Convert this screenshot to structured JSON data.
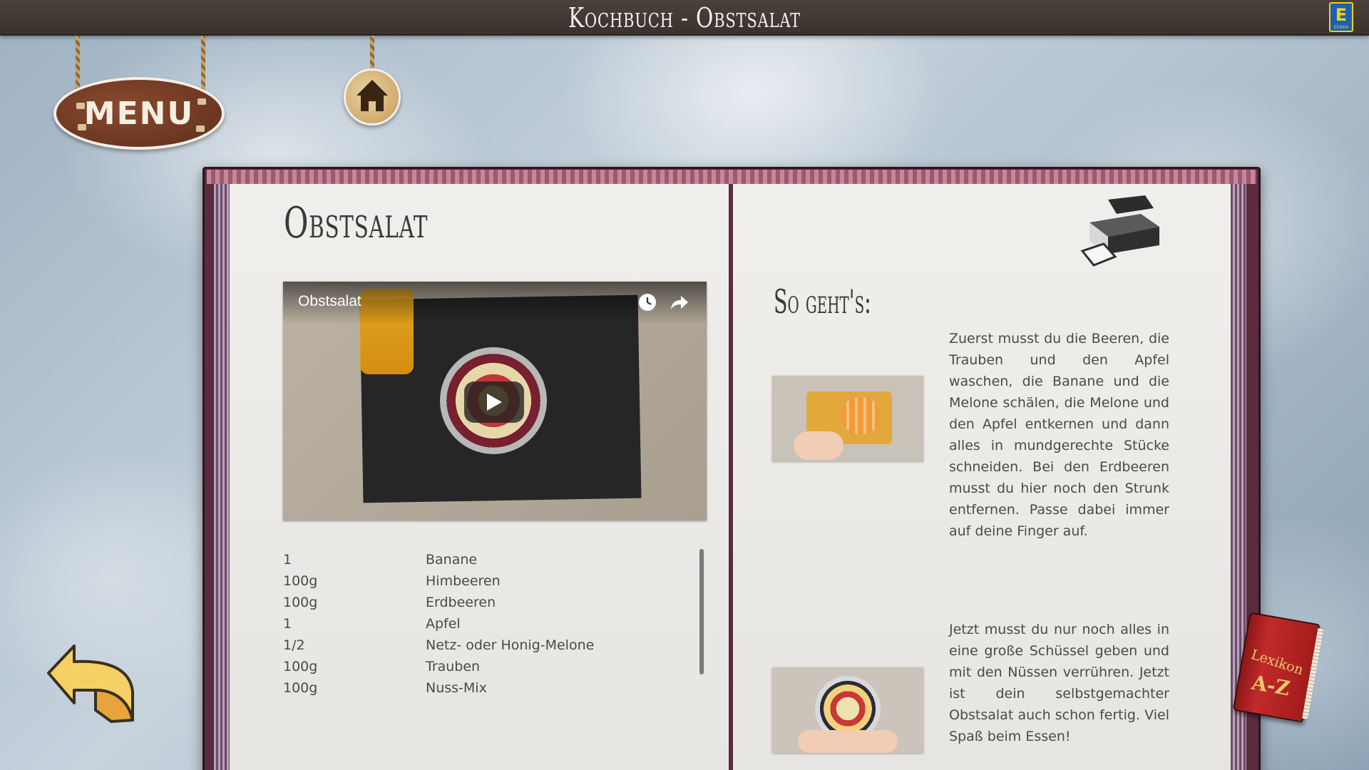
{
  "header": {
    "title": "Kochbuch - Obstsalat",
    "logo_letter": "E",
    "logo_word": "EDEKA"
  },
  "nav": {
    "menu_label": "MENU",
    "home_icon": "house-icon",
    "back_icon": "back-arrow-icon"
  },
  "recipe": {
    "title": "Obstsalat",
    "video": {
      "title": "Obstsalat",
      "watch_later_icon": "clock-icon",
      "share_icon": "share-icon",
      "play_icon": "play-icon"
    },
    "ingredients": [
      {
        "amount": "1",
        "name": "Banane"
      },
      {
        "amount": "100g",
        "name": "Himbeeren"
      },
      {
        "amount": "100g",
        "name": "Erdbeeren"
      },
      {
        "amount": "1",
        "name": "Apfel"
      },
      {
        "amount": "1/2",
        "name": "Netz- oder Honig-Melone"
      },
      {
        "amount": "100g",
        "name": "Trauben"
      },
      {
        "amount": "100g",
        "name": "Nuss-Mix"
      }
    ]
  },
  "instructions": {
    "title": "So geht's:",
    "print_icon": "printer-icon",
    "steps": [
      {
        "text": "Zuerst musst du die Beeren, die Trauben und den Apfel waschen, die Banane und die Melone schälen, die Melone und den Apfel entkernen und dann alles in mundgerechte Stücke schneiden. Bei den Erdbeeren musst du hier noch den Strunk entfernen. Passe dabei immer auf deine Finger auf."
      },
      {
        "text": "Jetzt musst du nur noch alles in eine große Schüssel geben und mit den Nüssen verrühren. Jetzt ist dein selbstgemachter Obstsalat auch schon fertig. Viel Spaß beim Essen!"
      }
    ]
  },
  "lexikon": {
    "label_top": "Lexikon",
    "label_bottom": "A-Z"
  },
  "colors": {
    "topbar": "#3f3731",
    "book_cover": "#5c2b3e",
    "page": "#efedea",
    "text": "#4a4a4a"
  }
}
